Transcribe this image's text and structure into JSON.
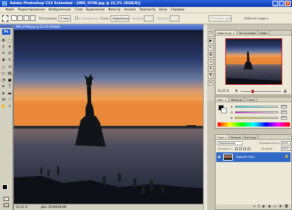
{
  "window": {
    "title": "Adobe Photoshop CS3 Extended - [IMG_0798.jpg @ 22,3% (RGB/8)]",
    "min_glyph": "_",
    "max_glyph": "□",
    "close_glyph": "×",
    "app_badge": "Ps"
  },
  "menu": [
    "Файл",
    "Редактирование",
    "Изображение",
    "Слой",
    "Выделение",
    "Фильтр",
    "Анализ",
    "Просмотр",
    "Окно",
    "Справка"
  ],
  "options": {
    "feather_label": "Растушевка:",
    "feather_value": "0 пикс",
    "smoothing_label": "Сглаживание",
    "style_label": "Стиль:",
    "style_value": "Нормальный",
    "width_label": "Ширина:",
    "height_label": "Высота:",
    "refine_button": "Уточнить край...",
    "workspace_label": "Рабочая среда ▾"
  },
  "document": {
    "title": "IMG_0798.jpg @ 22,3% (RGB/8)",
    "zoom": "22,31 %",
    "doc_size": "Док: 28,6M/28,6M"
  },
  "navigator": {
    "tabs": [
      "Навигатор ×",
      "Гистограмма",
      "Инфо"
    ],
    "zoom": "22,31 %"
  },
  "color_panel": {
    "tabs": [
      "Цвет ×",
      "Образцы",
      "Стили"
    ],
    "channels": [
      {
        "label": "R",
        "value": "255"
      },
      {
        "label": "G",
        "value": "255"
      },
      {
        "label": "B",
        "value": "255"
      }
    ]
  },
  "layers_panel": {
    "tabs": [
      "Слои ×",
      "Каналы",
      "Контуры"
    ],
    "blend_mode": "Нормальный",
    "opacity_label": "Непрозрачность:",
    "opacity_value": "100%",
    "lock_label": "Закрепить:",
    "fill_label": "Заливка:",
    "fill_value": "100%",
    "layers": [
      {
        "name": "Задний план",
        "selected": true,
        "locked": true
      }
    ]
  },
  "colors": {
    "accent_blue": "#0a3ab4",
    "selected_layer": "#3169c6"
  }
}
